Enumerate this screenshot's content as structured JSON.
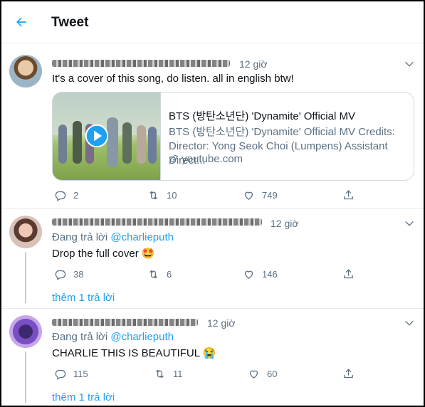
{
  "header": {
    "title": "Tweet"
  },
  "tweets": [
    {
      "time": "12 giờ",
      "text": "It's a cover of this song, do listen. all in english btw!",
      "card": {
        "title": "BTS (방탄소년단) 'Dynamite' Official MV",
        "desc": "BTS (방탄소년단) 'Dynamite' Official MV Credits: Director: Yong Seok Choi (Lumpens) Assistant Direct...",
        "link": "youtube.com"
      },
      "replies": "2",
      "retweets": "10",
      "likes": "749"
    },
    {
      "time": "12 giờ",
      "reply_prefix": "Đang trả lời",
      "reply_handle": "@charlieputh",
      "text": "Drop the full cover 🤩",
      "replies": "38",
      "retweets": "6",
      "likes": "146",
      "more": "thêm 1 trả lời"
    },
    {
      "time": "12 giờ",
      "reply_prefix": "Đang trả lời",
      "reply_handle": "@charlieputh",
      "text": "CHARLIE THIS IS BEAUTIFUL 😭",
      "replies": "115",
      "retweets": "11",
      "likes": "60",
      "more": "thêm 1 trả lời"
    }
  ],
  "colors": {
    "accent": "#1da1f2",
    "secondary_text": "#5b7083",
    "border": "#e6ecf0"
  },
  "icons": [
    "back-arrow-icon",
    "chevron-down-icon",
    "reply-icon",
    "retweet-icon",
    "like-icon",
    "share-icon",
    "play-icon",
    "link-icon"
  ]
}
